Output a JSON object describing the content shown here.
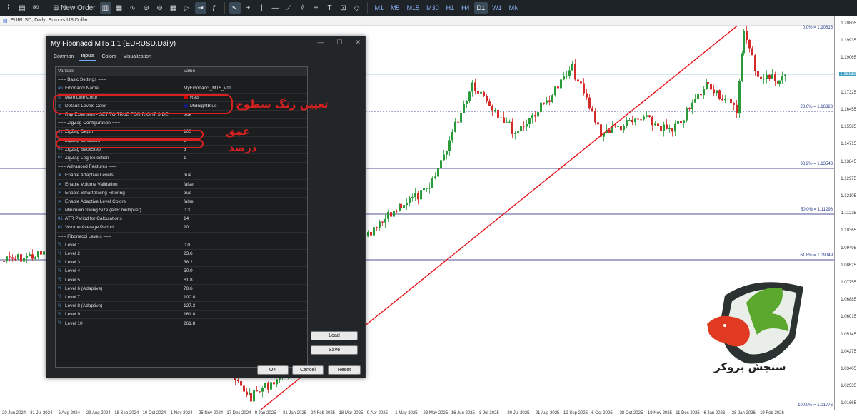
{
  "toolbar": {
    "new_order": "New Order",
    "timeframes": [
      "M1",
      "M5",
      "M15",
      "M30",
      "H1",
      "H4",
      "D1",
      "W1",
      "MN"
    ],
    "active_timeframe": "D1"
  },
  "chart": {
    "tab_label": "EURUSD, Daily: Euro vs US Dollar",
    "price_levels": [
      "1.20805",
      "1.19935",
      "1.19065",
      "1.18195",
      "1.17325",
      "1.16455",
      "1.15585",
      "1.14715",
      "1.13845",
      "1.12975",
      "1.12105",
      "1.11235",
      "1.10365",
      "1.09495",
      "1.08625",
      "1.07755",
      "1.06885",
      "1.06015",
      "1.05145",
      "1.04275",
      "1.03405",
      "1.02535",
      "1.01665"
    ],
    "current_price": "1.18183",
    "time_labels": [
      "20 Jun 2024",
      "31 Jul 2024",
      "5 Aug 2024",
      "29 Aug 2024",
      "18 Sep 2024",
      "10 Oct 2024",
      "1 Nov 2024",
      "25 Nov 2024",
      "17 Dec 2024",
      "9 Jan 2025",
      "31 Jan 2025",
      "24 Feb 2025",
      "18 Mar 2025",
      "9 Apr 2025",
      "1 May 2025",
      "23 May 2025",
      "16 Jun 2025",
      "8 Jul 2025",
      "30 Jul 2025",
      "21 Aug 2025",
      "12 Sep 2025",
      "6 Oct 2025",
      "28 Oct 2025",
      "19 Nov 2025",
      "11 Dec 2025",
      "6 Jan 2026",
      "28 Jan 2026",
      "19 Feb 2026"
    ],
    "fib_labels": [
      "0.0% = 1.20816",
      "23.6% = 1.16323",
      "38.2% = 1.13543",
      "50.0% = 1.11296",
      "61.8% = 1.09049",
      "100.0% = 1.01776"
    ]
  },
  "dialog": {
    "title": "My Fibonacci MT5 1.1 (EURUSD,Daily)",
    "tabs": [
      "Common",
      "Inputs",
      "Colors",
      "Visualization"
    ],
    "active_tab": "Inputs",
    "columns": [
      "Variable",
      "Value"
    ],
    "rows": [
      {
        "icon": "",
        "name": "=== Basic Settings ===",
        "value": ""
      },
      {
        "icon": "ab",
        "name": "Fibonacci Name",
        "value": "MyFibonacci_MT5_v11"
      },
      {
        "icon": "◎",
        "name": "Main Line Color",
        "value": "Red",
        "swatch": "#d00000"
      },
      {
        "icon": "◎",
        "name": "Default Levels Color",
        "value": "MidnightBlue",
        "swatch": "#191970"
      },
      {
        "icon": "⊁",
        "name": "Ray Extension - SET TO TRUE FOR RIGHT SIDE",
        "value": "true"
      },
      {
        "icon": "",
        "name": "=== ZigZag Configuration ===",
        "value": ""
      },
      {
        "icon": "01",
        "name": "ZigZag Depth",
        "value": "100"
      },
      {
        "icon": "01",
        "name": "ZigZag Deviation",
        "value": "5"
      },
      {
        "icon": "01",
        "name": "ZigZag BackStep",
        "value": "3"
      },
      {
        "icon": "01",
        "name": "ZigZag Leg Selection",
        "value": "1"
      },
      {
        "icon": "",
        "name": "=== Advanced Features ===",
        "value": ""
      },
      {
        "icon": "⊁",
        "name": "Enable Adaptive Levels",
        "value": "true"
      },
      {
        "icon": "⊁",
        "name": "Enable Volume Validation",
        "value": "false"
      },
      {
        "icon": "⊁",
        "name": "Enable Smart Swing Filtering",
        "value": "true"
      },
      {
        "icon": "⊁",
        "name": "Enable Adaptive Level Colors",
        "value": "false"
      },
      {
        "icon": "½",
        "name": "Minimum Swing Size (ATR multiplier)",
        "value": "0.3"
      },
      {
        "icon": "01",
        "name": "ATR Period for Calculations",
        "value": "14"
      },
      {
        "icon": "01",
        "name": "Volume Average Period",
        "value": "20"
      },
      {
        "icon": "",
        "name": "=== Fibonacci Levels ===",
        "value": ""
      },
      {
        "icon": "½",
        "name": "Level 1",
        "value": "0.0"
      },
      {
        "icon": "½",
        "name": "Level 2",
        "value": "23.6"
      },
      {
        "icon": "½",
        "name": "Level 3",
        "value": "38.2"
      },
      {
        "icon": "½",
        "name": "Level 4",
        "value": "50.0"
      },
      {
        "icon": "½",
        "name": "Level 5",
        "value": "61.8"
      },
      {
        "icon": "½",
        "name": "Level 6 (Adaptive)",
        "value": "78.6"
      },
      {
        "icon": "½",
        "name": "Level 7",
        "value": "100.0"
      },
      {
        "icon": "½",
        "name": "Level 8 (Adaptive)",
        "value": "127.2"
      },
      {
        "icon": "½",
        "name": "Level 9",
        "value": "161.8"
      },
      {
        "icon": "½",
        "name": "Level 10",
        "value": "261.8"
      }
    ],
    "load_label": "Load",
    "save_label": "Save",
    "ok_label": "OK",
    "cancel_label": "Cancel",
    "reset_label": "Reset"
  },
  "annotations": {
    "colors_note": "تعیین رنگ سطوح",
    "depth_note": "عمق",
    "deviation_note": "درصد"
  },
  "branding": {
    "logo_text": "سنجش بروکر"
  },
  "colors": {
    "fib_main": "#e8141a",
    "fib_level": "#191970",
    "bull": "#2a9a3a",
    "bear": "#d32a2a",
    "annotation": "#d42020"
  }
}
